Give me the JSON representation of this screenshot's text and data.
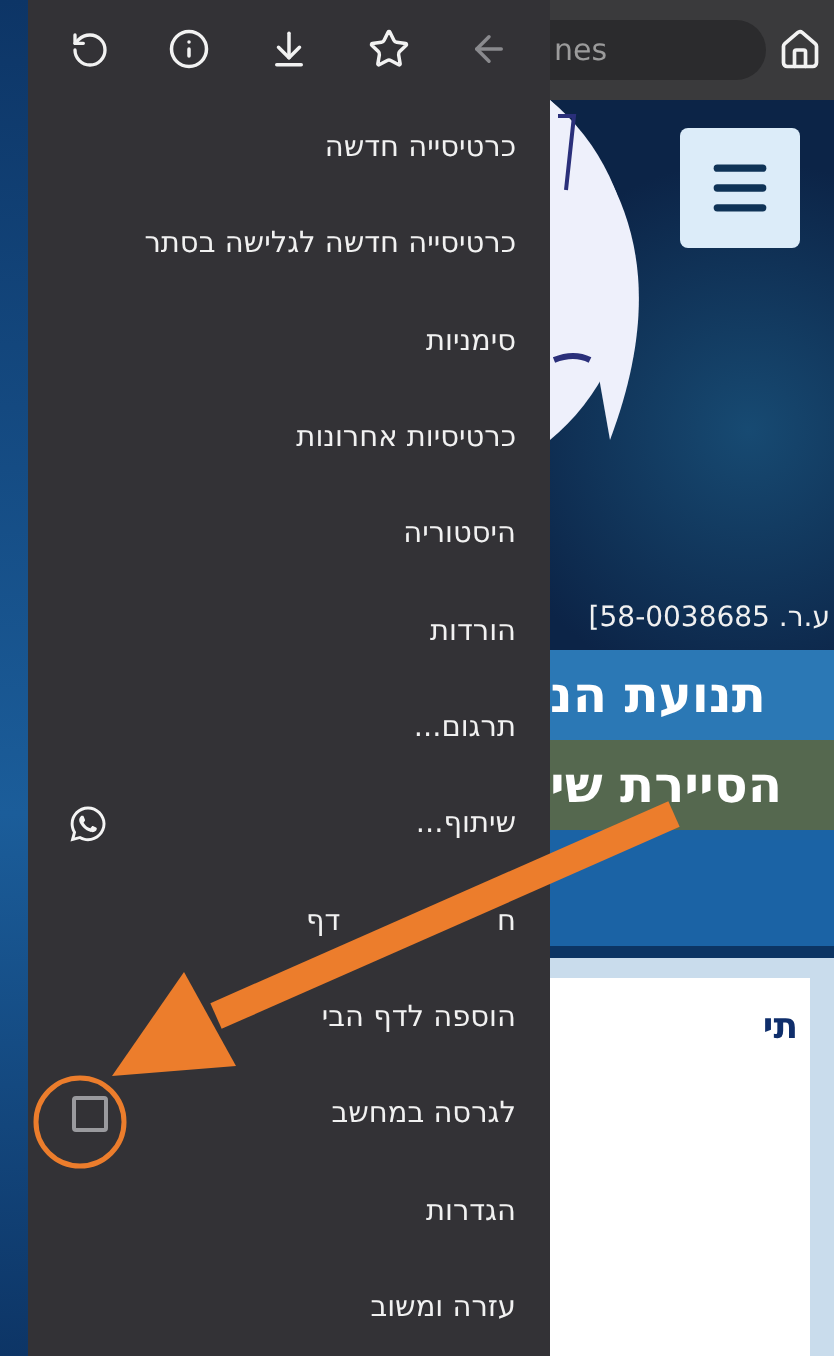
{
  "browser_bar": {
    "address_text": "nes"
  },
  "menu": {
    "items": [
      {
        "label": "כרטיסייה חדשה",
        "kind": "plain"
      },
      {
        "label": "כרטיסייה חדשה לגלישה בסתר",
        "kind": "plain"
      },
      {
        "label": "סימניות",
        "kind": "plain"
      },
      {
        "label": "כרטיסיות אחרונות",
        "kind": "plain"
      },
      {
        "label": "היסטוריה",
        "kind": "plain"
      },
      {
        "label": "הורדות",
        "kind": "plain"
      },
      {
        "label": "תרגום...",
        "kind": "plain"
      },
      {
        "label": "שיתוף...",
        "kind": "share"
      },
      {
        "label": "ח                 דף",
        "kind": "plain"
      },
      {
        "label": "הוספה לדף הבי",
        "kind": "plain"
      },
      {
        "label": "לגרסה במחשב",
        "kind": "checkbox",
        "checked": false
      },
      {
        "label": "הגדרות",
        "kind": "plain"
      },
      {
        "label": "עזרה ומשוב",
        "kind": "plain"
      }
    ]
  },
  "site": {
    "registration": "ע.ר. 58-0038685]",
    "banner_1": "תנועת הנ",
    "banner_2": "הסיירת שי",
    "card_heading": "תי"
  }
}
